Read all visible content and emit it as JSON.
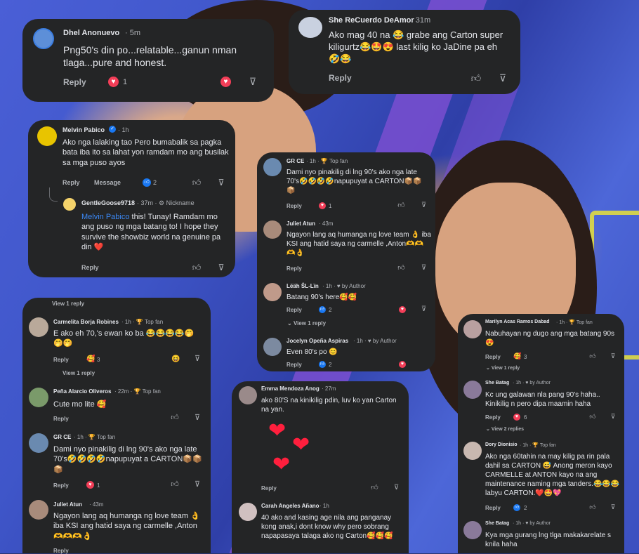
{
  "colors": {
    "card": "#242526",
    "text": "#e4e6eb",
    "muted": "#b0b3b8",
    "heart": "#f33e58",
    "like": "#1877f2",
    "mention": "#3b88f5"
  },
  "c1": {
    "name": "Dhel Anonuevo",
    "time": "5m",
    "text": "Png50's din po...relatable...ganun nman tlaga...pure and honest.",
    "reply": "Reply",
    "count": "1"
  },
  "c2": {
    "name": "She ReCuerdo DeAmor",
    "time": "31m",
    "text": "Ako mag 40 na 😂 grabe ang Carton super kiligurtz😂🤩😍 last kilig ko JaDine pa eh🤣😂",
    "reply": "Reply"
  },
  "c3": {
    "name": "Melvin Pabico",
    "time": "1h",
    "text": "Ako nga lalaking tao Pero bumabalik sa pagka bata iba ito sa lahat yon ramdam mo ang busilak sa mga puso ayos",
    "reply": "Reply",
    "message": "Message",
    "count": "2",
    "sub": {
      "name": "GentleGoose9718",
      "time": "37m",
      "nickname": "Nickname",
      "mention": "Melvin Pabico",
      "text": " this! Tunay! Ramdam mo ang puso ng mga batang to! I hope they survive the showbiz world na genuine pa din ❤️",
      "reply": "Reply"
    }
  },
  "c4": {
    "view": "View 1 reply",
    "name": "Carmelita Borja Robines",
    "time": "1h",
    "badge": "Top fan",
    "text": "E ako eh 70,'s ewan ko ba 😂😂😂😂🤭🤭🤭",
    "reply": "Reply",
    "count": "3",
    "view2": "View 1 reply"
  },
  "c5": {
    "name": "Peña Alarcio Oliveros",
    "time": "22m",
    "badge": "Top fan",
    "text": "Cute mo lite 🥰",
    "reply": "Reply"
  },
  "c6": {
    "name": "GR CE",
    "time": "1h",
    "badge": "Top fan",
    "text": "Dami nyo pinakilig di lng 90's ako nga late 70's🤣🤣🤣🤣napupuyat a CARTON📦📦📦",
    "reply": "Reply",
    "count": "1"
  },
  "c7": {
    "name": "Juliet Atun",
    "time": "43m",
    "text": "Ngayon lang aq humanga ng love team 👌 iba KSI ang hatid saya ng carmelle ,Anton🫶🫶🫶👌",
    "reply": "Reply"
  },
  "m1": {
    "name": "GR CE",
    "time": "1h",
    "badge": "Top fan",
    "text": "Dami nyo pinakilig di lng 90's ako nga late 70's🤣🤣🤣🤣napupuyat a CARTON📦📦📦",
    "reply": "Reply",
    "count": "1"
  },
  "m2": {
    "name": "Juliet Atun",
    "time": "43m",
    "text": "Ngayon lang aq humanga ng love team 👌 iba KSI ang hatid saya ng carmelle ,Anton🫶🫶🫶👌",
    "reply": "Reply"
  },
  "m3": {
    "name": "Lëäh ŜL-Lïn",
    "time": "1h",
    "badge": "by Author",
    "text": "Batang 90's here🥰🥰",
    "reply": "Reply",
    "count": "2",
    "view": "View 1 reply"
  },
  "m4": {
    "name": "Jocelyn Opeña Aspiras",
    "time": "1h",
    "badge": "by Author",
    "text": "Even 80's po 😊",
    "reply": "Reply",
    "count": "2"
  },
  "e1": {
    "name": "Emma Mendoza Anog",
    "time": "27m",
    "text": "ako 80'S na kinikilig pdin, luv ko yan Carton na yan.",
    "reply": "Reply"
  },
  "e2": {
    "name": "Carah Angeles Añano",
    "time": "1h",
    "text": "40 ako and kasing age nila ang panganay kong anak,i dont know why pero sobrang napapasaya talaga ako ng Carton🥰🥰🥰"
  },
  "r1": {
    "name": "Marilyn Acas Ramos Dabad",
    "time": "1h",
    "badge": "Top fan",
    "text": "Nabuhayan ng dugo ang mga batang 90s😍",
    "reply": "Reply",
    "count": "3",
    "view": "View 1 reply"
  },
  "r2": {
    "name": "She Batag",
    "time": "1h",
    "badge": "by Author",
    "text": "Kc ung galawan nla pang 90's haha.. Kinikilig n pero dipa maamin haha",
    "reply": "Reply",
    "count": "6",
    "view": "View 2 replies"
  },
  "r3": {
    "name": "Dory Dionisio",
    "time": "1h",
    "badge": "Top fan",
    "text": "Ako nga 60tahin na may kilig pa rin pala dahil sa CARTON 😅 Anong meron kayo CARMELLE at ANTON kayo na ang maintenance naming mga tanders.😂😂😂labyu CARTON.❤️🤩💖",
    "reply": "Reply",
    "count": "2"
  },
  "r4": {
    "name": "She Batag",
    "time": "1h",
    "badge": "by Author",
    "text": "Kya mga gurang lng tlga makakarelate s knila haha"
  }
}
